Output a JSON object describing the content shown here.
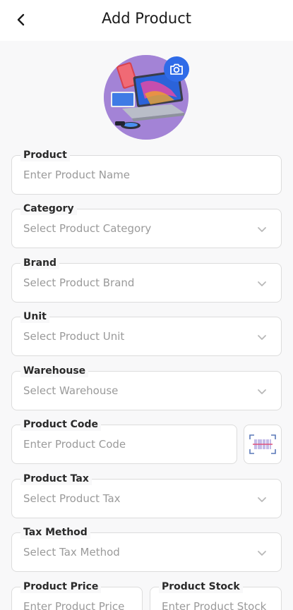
{
  "header": {
    "title": "Add Product"
  },
  "form": {
    "product": {
      "label": "Product",
      "placeholder": "Enter Product Name"
    },
    "category": {
      "label": "Category",
      "placeholder": "Select Product Category"
    },
    "brand": {
      "label": "Brand",
      "placeholder": "Select Product Brand"
    },
    "unit": {
      "label": "Unit",
      "placeholder": "Select Product Unit"
    },
    "warehouse": {
      "label": "Warehouse",
      "placeholder": "Select Warehouse"
    },
    "code": {
      "label": "Product Code",
      "placeholder": "Enter Product Code"
    },
    "tax": {
      "label": "Product Tax",
      "placeholder": "Select Product Tax"
    },
    "tax_method": {
      "label": "Tax Method",
      "placeholder": "Select Tax Method"
    },
    "price": {
      "label": "Product Price",
      "placeholder": "Enter Product Price"
    },
    "stock": {
      "label": "Product Stock",
      "placeholder": "Enter Product Stock"
    }
  },
  "icons": {
    "back": "chevron-left-icon",
    "camera": "camera-icon",
    "barcode": "barcode-scan-icon",
    "dropdown": "chevron-down-icon"
  },
  "colors": {
    "accent": "#2f6be8",
    "avatar_bg": "#a383d6",
    "border": "#dcdcdc",
    "placeholder": "#9a9a9a",
    "page_bg": "#f8f8f9"
  }
}
